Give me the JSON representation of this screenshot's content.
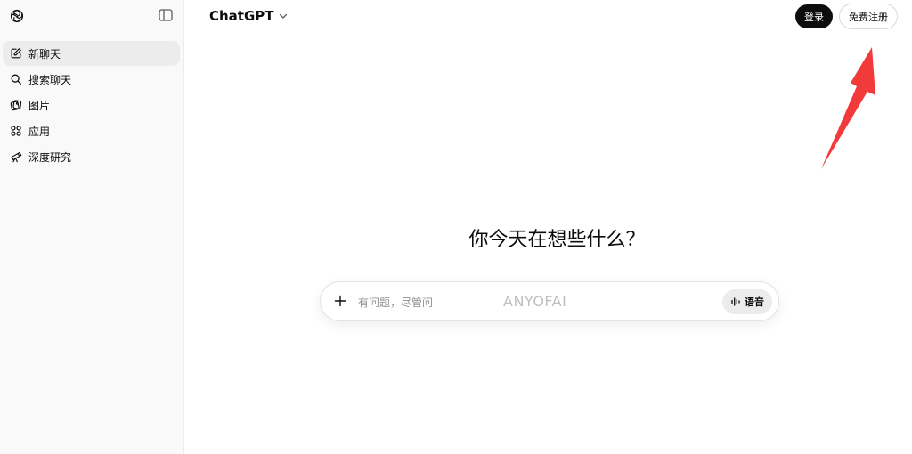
{
  "sidebar": {
    "items": [
      {
        "label": "新聊天",
        "icon": "edit-icon"
      },
      {
        "label": "搜索聊天",
        "icon": "search-icon"
      },
      {
        "label": "图片",
        "icon": "images-icon"
      },
      {
        "label": "应用",
        "icon": "apps-icon"
      },
      {
        "label": "深度研究",
        "icon": "telescope-icon"
      }
    ]
  },
  "header": {
    "model_name": "ChatGPT",
    "login_label": "登录",
    "signup_label": "免费注册"
  },
  "main": {
    "headline": "你今天在想些什么？",
    "composer": {
      "placeholder": "有问题，尽管问",
      "voice_label": "语音"
    },
    "watermark": "ANYOFAI"
  },
  "colors": {
    "annotation_arrow": "#f23a3a",
    "primary_button": "#0d0d0d",
    "sidebar_bg": "#f9f9f9"
  }
}
